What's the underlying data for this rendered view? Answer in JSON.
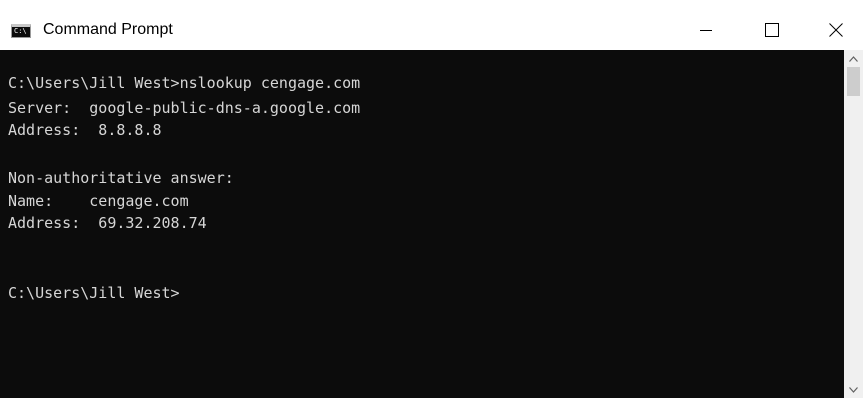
{
  "window": {
    "title": "Command Prompt",
    "icon": "cmd-app-icon",
    "icon_text": "C:\\",
    "controls": {
      "minimize": "minimize-icon",
      "maximize": "maximize-icon",
      "close": "close-icon"
    }
  },
  "console": {
    "background": "#0c0c0c",
    "foreground": "#d6d6d6",
    "lines": [
      "C:\\Users\\Jill West>nslookup cengage.com",
      "Server:  google-public-dns-a.google.com",
      "Address:  8.8.8.8",
      "",
      "Non-authoritative answer:",
      "Name:    cengage.com",
      "Address:  69.32.208.74",
      "",
      "",
      "C:\\Users\\Jill West>"
    ]
  },
  "scrollbar": {
    "up": "scroll-up-arrow-icon",
    "down": "scroll-down-arrow-icon"
  }
}
